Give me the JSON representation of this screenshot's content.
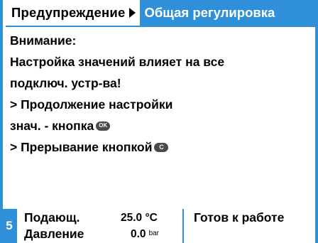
{
  "header": {
    "breadcrumb": "Предупреждение",
    "active_tab": "Общая регулировка"
  },
  "message": {
    "line1": "Внимание:",
    "line2": "Настройка значений влияет на все",
    "line3": "подключ. устр-ва!",
    "line4": "> Продолжение настройки",
    "line5": "знач. - кнопка",
    "line5_key": "OK",
    "line6": "> Прерывание кнопкой",
    "line6_key": "C"
  },
  "footer": {
    "circuit_number": "5",
    "flow_label": "Подающ.",
    "flow_value": "25.0",
    "flow_unit": "°C",
    "pressure_label": "Давление",
    "pressure_value": "0.0",
    "pressure_unit": "bar",
    "status": "Готов к работе"
  },
  "colors": {
    "accent": "#2f8fd8",
    "background": "#ffffff",
    "text": "#000000"
  }
}
